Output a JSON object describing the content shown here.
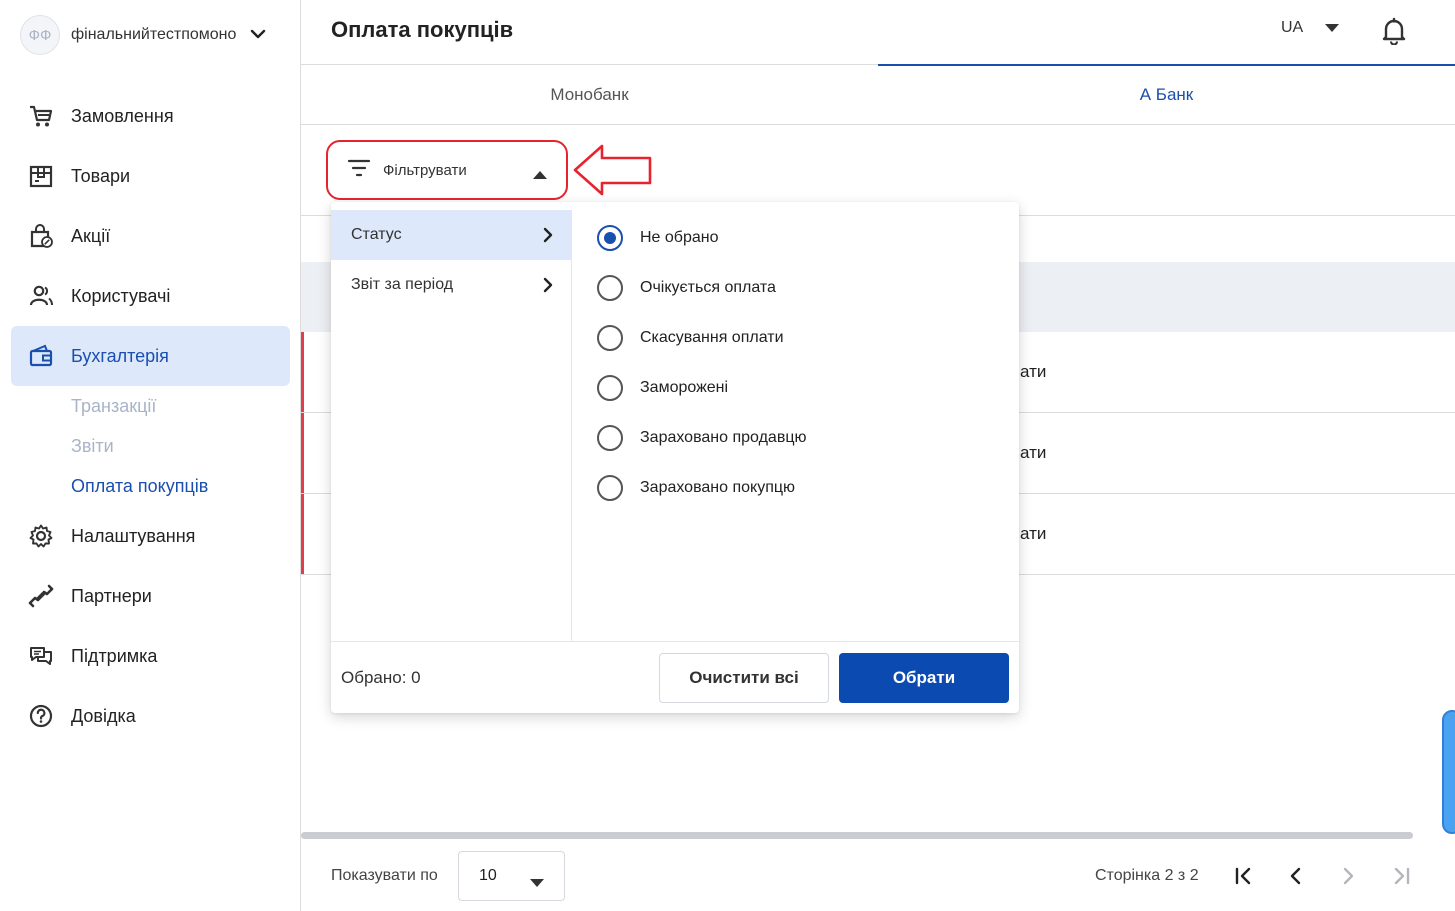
{
  "account": {
    "initials": "ФФ",
    "name": "фінальнийтестпомоно"
  },
  "sidebar": {
    "items": [
      {
        "label": "Замовлення",
        "icon": "cart-icon"
      },
      {
        "label": "Товари",
        "icon": "box-icon"
      },
      {
        "label": "Акції",
        "icon": "promo-bag-icon"
      },
      {
        "label": "Користувачі",
        "icon": "users-icon"
      },
      {
        "label": "Бухгалтерія",
        "icon": "wallet-icon",
        "active": true
      },
      {
        "label": "Налаштування",
        "icon": "gear-icon"
      },
      {
        "label": "Партнери",
        "icon": "handshake-icon"
      },
      {
        "label": "Підтримка",
        "icon": "chat-icon"
      },
      {
        "label": "Довідка",
        "icon": "help-icon"
      }
    ],
    "subitems": [
      {
        "label": "Транзакції"
      },
      {
        "label": "Звіти"
      },
      {
        "label": "Оплата покупців",
        "active": true
      }
    ]
  },
  "header": {
    "title": "Оплата покупців",
    "language": "UA"
  },
  "tabs": [
    {
      "label": "Монобанк"
    },
    {
      "label": "А Банк",
      "active": true
    }
  ],
  "filter": {
    "label": "Фільтрувати"
  },
  "popup": {
    "categories": [
      {
        "label": "Статус",
        "active": true
      },
      {
        "label": "Звіт за період"
      }
    ],
    "options": [
      {
        "label": "Не обрано",
        "checked": true
      },
      {
        "label": "Очікується оплата"
      },
      {
        "label": "Скасування оплати"
      },
      {
        "label": "Заморожені"
      },
      {
        "label": "Зараховано продавцю"
      },
      {
        "label": "Зараховано покупцю"
      }
    ],
    "selected_label": "Обрано: 0",
    "clear_label": "Очистити всі",
    "apply_label": "Обрати"
  },
  "table": {
    "row_fragments": [
      "ати",
      "ати",
      "ати"
    ]
  },
  "pagination": {
    "per_page_label": "Показувати по",
    "per_page_value": "10",
    "page_info": "Сторінка 2 з 2"
  },
  "colors": {
    "accent": "#1a4fae",
    "primary_button": "#0b4bb1",
    "annotation": "#e62430",
    "active_bg": "#dde8fb"
  }
}
